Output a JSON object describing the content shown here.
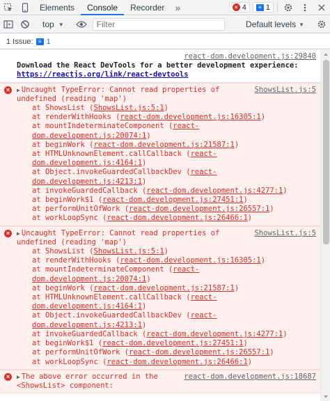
{
  "tabbar": {
    "tabs": [
      "Elements",
      "Console",
      "Recorder"
    ],
    "active_tab": "Console",
    "more": "»",
    "error_count": "4",
    "message_count": "1",
    "icons": [
      "inspect-icon",
      "device-toggle-icon",
      "gear-icon",
      "kebab-menu-icon",
      "close-icon"
    ]
  },
  "toolbar": {
    "context": "top",
    "filter_placeholder": "Filter",
    "levels": "Default levels"
  },
  "issues": {
    "label": "1 Issue:",
    "count": "1"
  },
  "log": {
    "info": {
      "source": "react-dom.development.js:29840",
      "text": "Download the React DevTools for a better development experience: ",
      "link": "https://reactjs.org/link/react-devtools"
    },
    "errors": [
      {
        "source": "ShowsList.js:5",
        "message": "Uncaught TypeError: Cannot read properties of undefined (reading 'map')",
        "frames": [
          {
            "fn": "at ShowsList",
            "ref": "ShowsList.js:5:1"
          },
          {
            "fn": "at renderWithHooks",
            "ref": "react-dom.development.js:16305:1"
          },
          {
            "fn": "at mountIndeterminateComponent",
            "ref": "react-dom.development.js:20074:1"
          },
          {
            "fn": "at beginWork",
            "ref": "react-dom.development.js:21587:1"
          },
          {
            "fn": "at HTMLUnknownElement.callCallback",
            "ref": "react-dom.development.js:4164:1"
          },
          {
            "fn": "at Object.invokeGuardedCallbackDev",
            "ref": "react-dom.development.js:4213:1"
          },
          {
            "fn": "at invokeGuardedCallback",
            "ref": "react-dom.development.js:4277:1"
          },
          {
            "fn": "at beginWork$1",
            "ref": "react-dom.development.js:27451:1"
          },
          {
            "fn": "at performUnitOfWork",
            "ref": "react-dom.development.js:26557:1"
          },
          {
            "fn": "at workLoopSync",
            "ref": "react-dom.development.js:26466:1"
          }
        ]
      },
      {
        "source": "ShowsList.js:5",
        "message": "Uncaught TypeError: Cannot read properties of undefined (reading 'map')",
        "frames": [
          {
            "fn": "at ShowsList",
            "ref": "ShowsList.js:5:1"
          },
          {
            "fn": "at renderWithHooks",
            "ref": "react-dom.development.js:16305:1"
          },
          {
            "fn": "at mountIndeterminateComponent",
            "ref": "react-dom.development.js:20074:1"
          },
          {
            "fn": "at beginWork",
            "ref": "react-dom.development.js:21587:1"
          },
          {
            "fn": "at HTMLUnknownElement.callCallback",
            "ref": "react-dom.development.js:4164:1"
          },
          {
            "fn": "at Object.invokeGuardedCallbackDev",
            "ref": "react-dom.development.js:4213:1"
          },
          {
            "fn": "at invokeGuardedCallback",
            "ref": "react-dom.development.js:4277:1"
          },
          {
            "fn": "at beginWork$1",
            "ref": "react-dom.development.js:27451:1"
          },
          {
            "fn": "at performUnitOfWork",
            "ref": "react-dom.development.js:26557:1"
          },
          {
            "fn": "at workLoopSync",
            "ref": "react-dom.development.js:26466:1"
          }
        ]
      },
      {
        "source": "react-dom.development.js:18687",
        "message": "The above error occurred in the <ShowsList> component:",
        "frames": []
      }
    ]
  },
  "colors": {
    "accent": "#1a73e8",
    "error": "#d93025",
    "error_bg": "#fff0f0"
  }
}
